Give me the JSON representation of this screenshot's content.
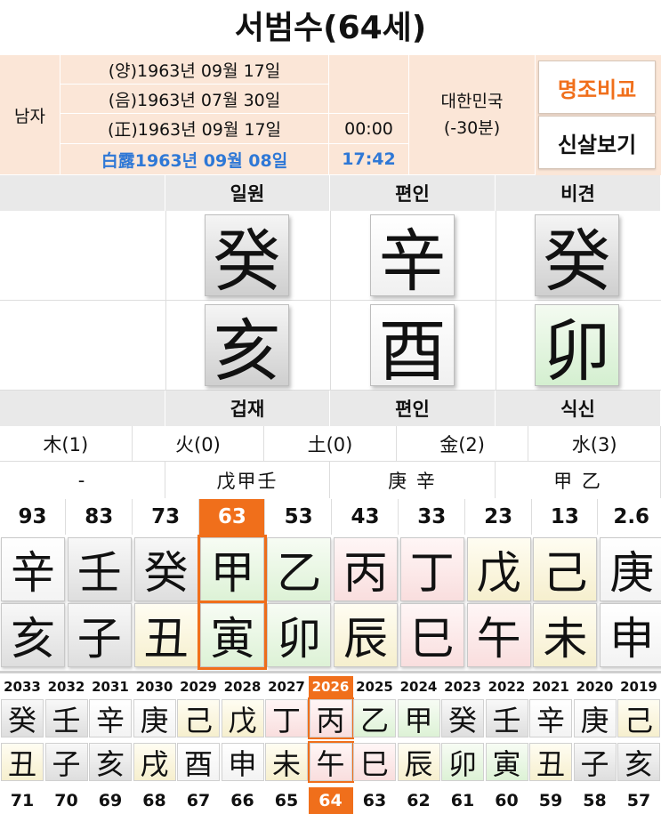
{
  "title": "서범수(64세)",
  "info": {
    "gender": "남자",
    "solar": "(양)1963년 09월 17일",
    "lunar": "(음)1963년 07월 30일",
    "corrected": "(正)1963년 09월 17일",
    "corrected_time": "00:00",
    "term": "白露1963년 09월 08일",
    "term_time": "17:42",
    "country": "대한민국",
    "offset": "(-30분)",
    "compare_button": "명조비교",
    "sinsal_button": "신살보기",
    "compare_color": "#f06f1b"
  },
  "top_labels": [
    "",
    "일원",
    "편인",
    "비견"
  ],
  "stems": [
    "癸",
    "辛",
    "癸"
  ],
  "branches": [
    "亥",
    "酉",
    "卯"
  ],
  "bottom_labels": [
    "",
    "겁재",
    "편인",
    "식신"
  ],
  "elements": [
    "木(1)",
    "火(0)",
    "土(0)",
    "金(2)",
    "水(3)"
  ],
  "hidden_stems": [
    "-",
    "戊甲壬",
    "庚 辛",
    "甲 乙"
  ],
  "daewoon": {
    "ages": [
      "93",
      "83",
      "73",
      "63",
      "53",
      "43",
      "33",
      "23",
      "13",
      "2.6"
    ],
    "current_index": 3,
    "stems": [
      "辛",
      "壬",
      "癸",
      "甲",
      "乙",
      "丙",
      "丁",
      "戊",
      "己",
      "庚"
    ],
    "branches": [
      "亥",
      "子",
      "丑",
      "寅",
      "卯",
      "辰",
      "巳",
      "午",
      "未",
      "申"
    ]
  },
  "years": {
    "labels": [
      "2033",
      "2032",
      "2031",
      "2030",
      "2029",
      "2028",
      "2027",
      "2026",
      "2025",
      "2024",
      "2023",
      "2022",
      "2021",
      "2020",
      "2019"
    ],
    "current_index": 7,
    "stems": [
      "癸",
      "壬",
      "辛",
      "庚",
      "己",
      "戊",
      "丁",
      "丙",
      "乙",
      "甲",
      "癸",
      "壬",
      "辛",
      "庚",
      "己"
    ],
    "branches": [
      "丑",
      "子",
      "亥",
      "戌",
      "酉",
      "申",
      "未",
      "午",
      "巳",
      "辰",
      "卯",
      "寅",
      "丑",
      "子",
      "亥"
    ],
    "ages": [
      "71",
      "70",
      "69",
      "68",
      "67",
      "66",
      "65",
      "64",
      "63",
      "62",
      "61",
      "60",
      "59",
      "58",
      "57"
    ]
  },
  "highlight_color": "#f06f1b"
}
